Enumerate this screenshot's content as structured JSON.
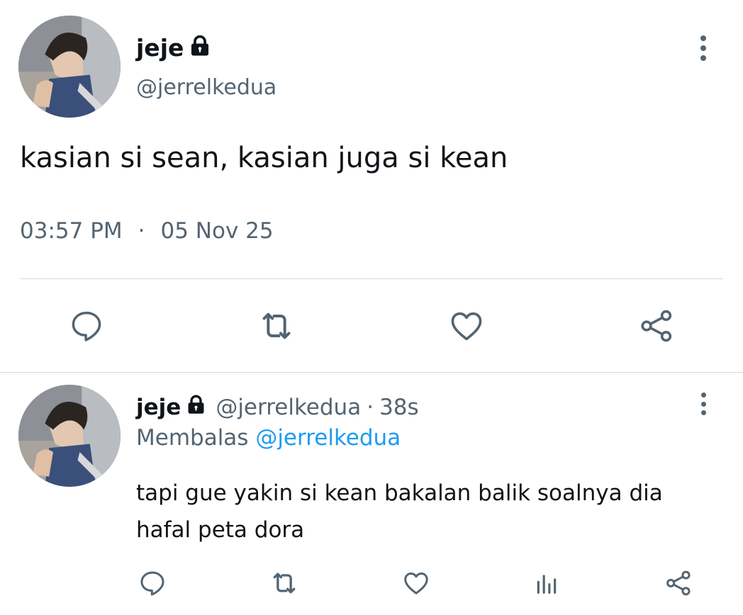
{
  "main_tweet": {
    "display_name": "jeje",
    "handle": "@jerrelkedua",
    "text": "kasian si sean, kasian juga si kean",
    "time": "03:57 PM",
    "separator": "·",
    "date": "05 Nov 25"
  },
  "reply": {
    "display_name": "jeje",
    "handle": "@jerrelkedua",
    "separator": "·",
    "age": "38s",
    "replying_prefix": "Membalas",
    "replying_to": "@jerrelkedua",
    "text_line1": "tapi gue yakin si kean bakalan balik soalnya dia",
    "text_line2": "hafal peta dora"
  },
  "icons": {
    "lock": "lock-icon",
    "more": "more-vertical-icon",
    "reply": "speech-bubble-icon",
    "retweet": "retweet-icon",
    "like": "heart-icon",
    "share": "share-icon",
    "views": "bar-chart-icon"
  },
  "colors": {
    "text": "#0f1419",
    "secondary": "#536471",
    "link": "#1d9bf0",
    "divider": "#cfd9de"
  }
}
